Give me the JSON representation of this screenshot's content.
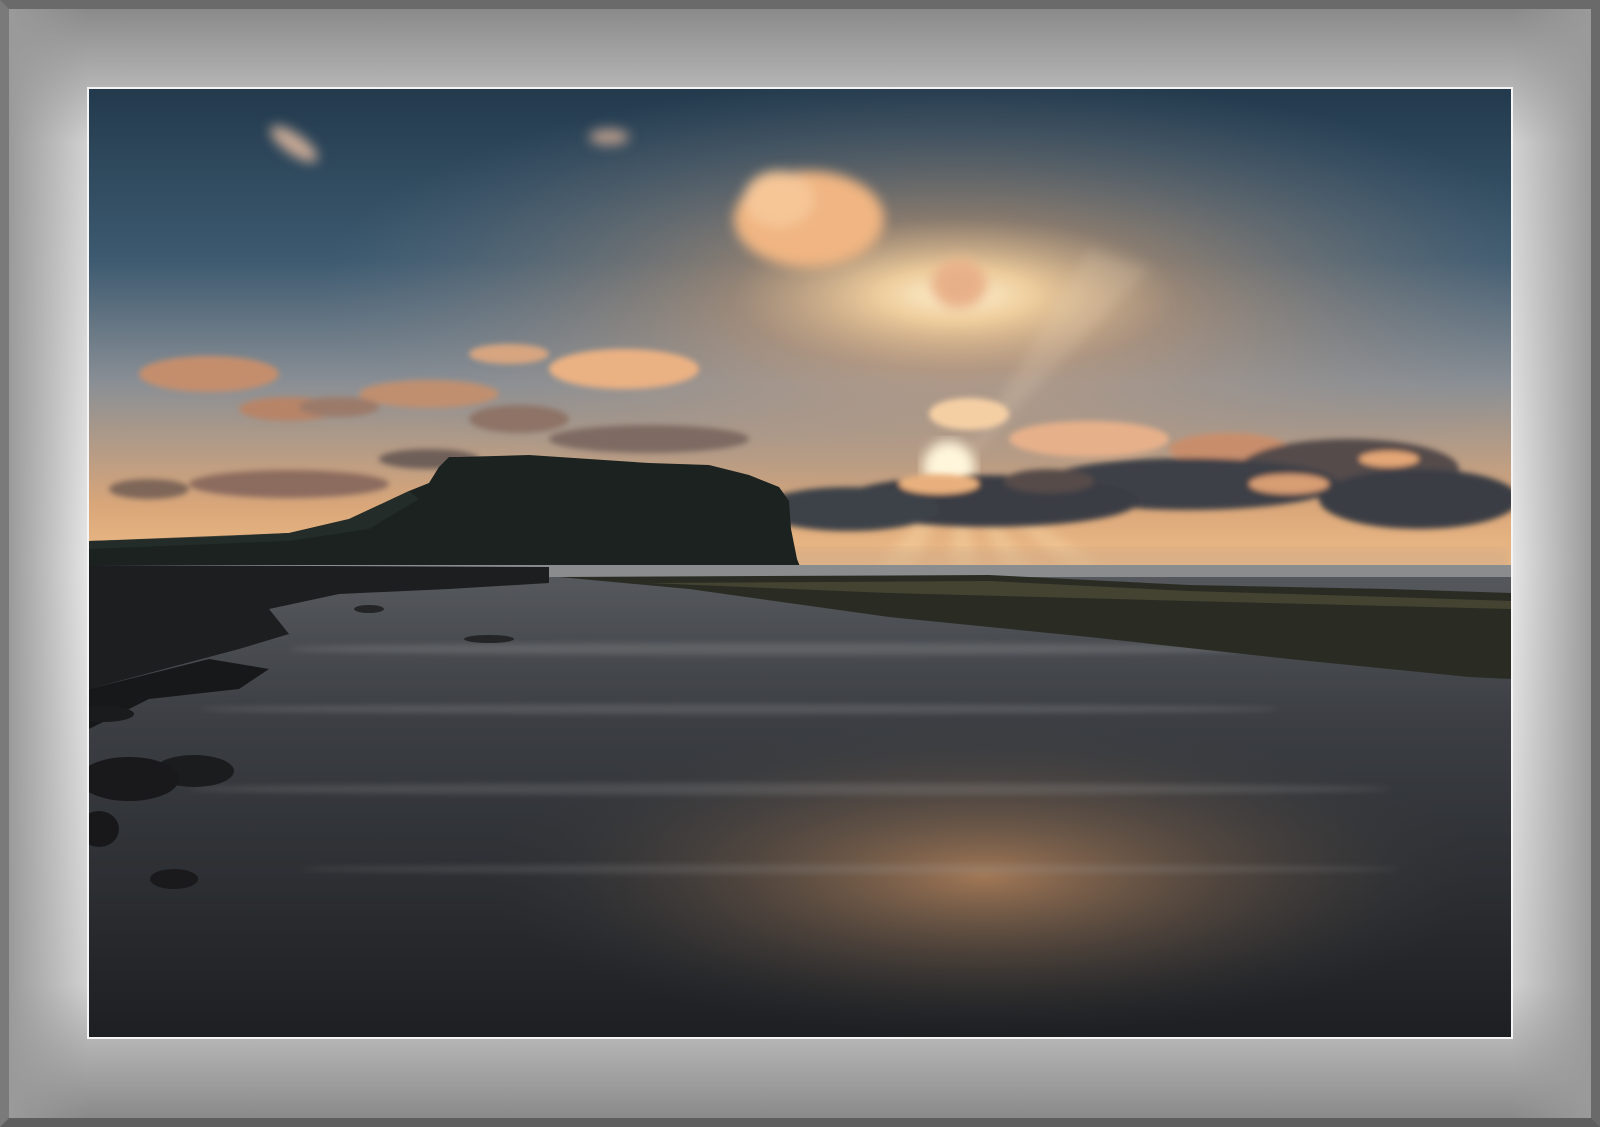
{
  "image": {
    "scene": "seaside-sunset",
    "colors": {
      "frame": "#d9d9d9",
      "sky_top": "#243a4c",
      "sky_horizon": "#f3c48a",
      "sun": "#fff1cf",
      "cloud_lit": "#f1b27a",
      "cloud_dark": "#3e4450",
      "headland": "#1c2320",
      "water": "#2f3236"
    }
  }
}
